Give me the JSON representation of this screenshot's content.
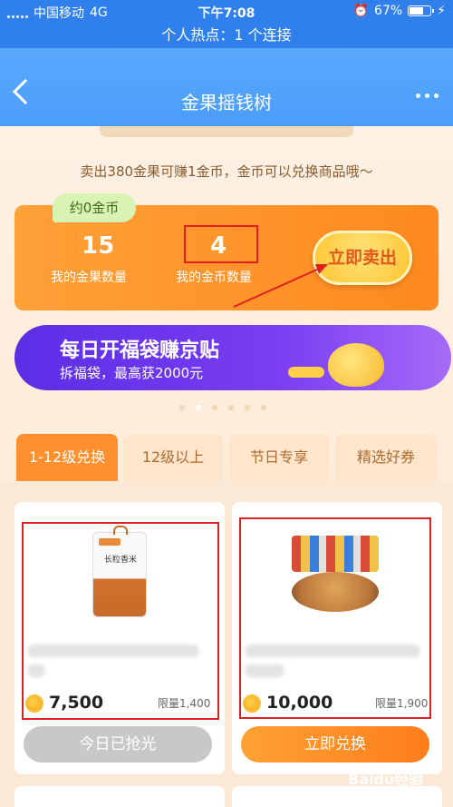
{
  "status_bar": {
    "carrier": "中国移动",
    "network": "4G",
    "time": "下午7:08",
    "battery": "67%",
    "battery_level": 0.67
  },
  "hotspot": "个人热点：1 个连接",
  "nav": {
    "title": "金果摇钱树"
  },
  "notice": "卖出380金果可赚1金币，金币可以兑换商品哦～",
  "summary": {
    "bubble": "约0金币",
    "fruit_count": "15",
    "fruit_label": "我的金果数量",
    "coin_count": "4",
    "coin_label": "我的金币数量",
    "sell_button": "立即卖出"
  },
  "banner": {
    "title": "每日开福袋赚京贴",
    "subtitle": "拆福袋，最高获2000元"
  },
  "carousel": {
    "total": 6,
    "active": 1
  },
  "tabs": [
    {
      "label": "1-12级兑换",
      "active": true
    },
    {
      "label": "12级以上",
      "active": false
    },
    {
      "label": "节日专享",
      "active": false
    },
    {
      "label": "精选好券",
      "active": false
    }
  ],
  "products": [
    {
      "image_text": "长粒香米",
      "price": "7,500",
      "limit": "限量1,400",
      "button": "今日已抢光",
      "available": false
    },
    {
      "image_text": "",
      "price": "10,000",
      "limit": "限量1,900",
      "button": "立即兑换",
      "available": true
    }
  ],
  "watermark": "Baidu经验",
  "colors": {
    "primary_blue": "#2f80ed",
    "orange": "#ff8a1f",
    "purple": "#6a35ec",
    "highlight_red": "#e02020"
  }
}
